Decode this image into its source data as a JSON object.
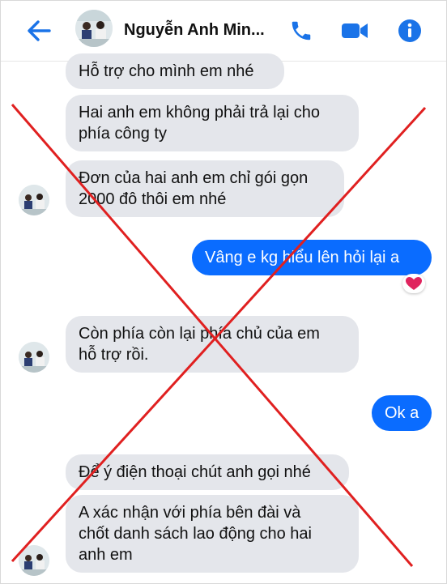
{
  "header": {
    "contact_name": "Nguyễn Anh Min...",
    "back_icon": "arrow-left-icon",
    "call_icon": "phone-icon",
    "video_icon": "video-camera-icon",
    "info_icon": "info-icon"
  },
  "messages": [
    {
      "direction": "in",
      "lines": [
        "Hỗ trợ cho mình em nhé"
      ]
    },
    {
      "direction": "in",
      "lines": [
        "Hai anh em không phải trả lại cho",
        "phía công ty"
      ]
    },
    {
      "direction": "in",
      "lines": [
        "Đơn của hai anh em chỉ gói gọn",
        "2000 đô thôi em nhé"
      ]
    },
    {
      "direction": "out",
      "lines": [
        "Vâng e kg hiểu lên hỏi lại a"
      ],
      "reaction": "heart"
    },
    {
      "direction": "in",
      "lines": [
        "Còn phía còn lại phía chủ của em",
        "hỗ trợ rồi."
      ]
    },
    {
      "direction": "out",
      "lines": [
        "Ok a"
      ]
    },
    {
      "direction": "in",
      "lines": [
        "Để ý điện thoại chút anh gọi nhé"
      ]
    },
    {
      "direction": "in",
      "lines": [
        "A xác nhận với phía bên đài và",
        "chốt danh sách lao động cho hai",
        "anh em"
      ]
    }
  ],
  "colors": {
    "accent": "#0a6cff",
    "incoming_bubble": "#e4e6eb",
    "cross_overlay": "#e02020",
    "reaction_heart": "#e0245e"
  }
}
